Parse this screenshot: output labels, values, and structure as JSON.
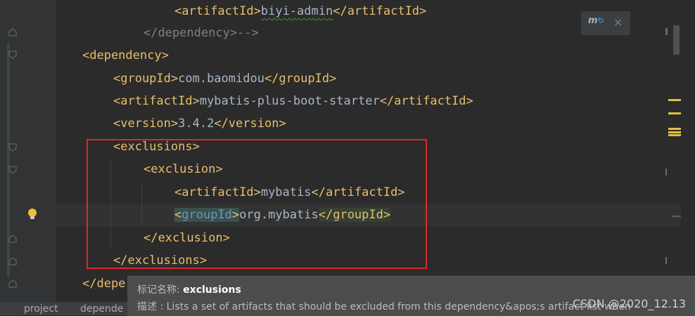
{
  "editor": {
    "lines": [
      {
        "id": "l1",
        "open": "<",
        "name": "artifactId",
        "close": ">",
        "text": "biyi-admin",
        "end": "</artifactId>"
      },
      {
        "id": "l2",
        "comment": "</dependency>-->"
      },
      {
        "id": "l3",
        "tag": "<dependency>"
      },
      {
        "id": "l4",
        "open": "<groupId>",
        "text": "com.baomidou",
        "end": "</groupId>"
      },
      {
        "id": "l5",
        "open": "<artifactId>",
        "text": "mybatis-plus-boot-starter",
        "end": "</artifactId>"
      },
      {
        "id": "l6",
        "open": "<version>",
        "text": "3.4.2",
        "end": "</version>"
      },
      {
        "id": "l7",
        "tag": "<exclusions>"
      },
      {
        "id": "l8",
        "tag": "<exclusion>"
      },
      {
        "id": "l9",
        "open": "<artifactId>",
        "text": "mybatis",
        "end": "</artifactId>"
      },
      {
        "id": "l10",
        "open_lt": "<",
        "open_name": "groupId",
        "open_gt": ">",
        "text": "org.mybatis",
        "end": "</groupId>"
      },
      {
        "id": "l11",
        "tag": "</exclusion>"
      },
      {
        "id": "l12",
        "tag": "</exclusions>"
      },
      {
        "id": "l13",
        "tag": "</depe"
      }
    ]
  },
  "maven_popup": {
    "icon": "maven-reload-icon",
    "close": "×"
  },
  "tooltip": {
    "label1": "标记名称: ",
    "value1": "exclusions",
    "label2": "描述 : ",
    "value2": "Lists a set of artifacts that should be excluded from this dependency&apos;s artifact list when"
  },
  "statusbar": {
    "crumb1": "project",
    "crumb2": "depende"
  },
  "watermark": "CSDN @2020_12.13",
  "colors": {
    "tag": "#e8bf6a",
    "text": "#a9b7c6",
    "comment": "#808080",
    "background": "#2b2b2b",
    "highlight_box": "#e0272a"
  }
}
